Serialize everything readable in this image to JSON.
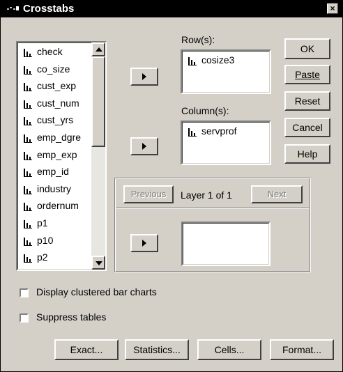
{
  "window": {
    "title": "Crosstabs",
    "close_glyph": "×"
  },
  "variables": [
    "check",
    "co_size",
    "cust_exp",
    "cust_num",
    "cust_yrs",
    "emp_dgre",
    "emp_exp",
    "emp_id",
    "industry",
    "ordernum",
    "p1",
    "p10",
    "p2"
  ],
  "rows": {
    "label": "Row(s):",
    "items": [
      "cosize3"
    ]
  },
  "columns": {
    "label": "Column(s):",
    "items": [
      "servprof"
    ]
  },
  "layer": {
    "previous": "Previous",
    "text": "Layer 1 of 1",
    "next": "Next",
    "items": []
  },
  "buttons": {
    "ok": "OK",
    "paste": "Paste",
    "reset": "Reset",
    "cancel": "Cancel",
    "help": "Help"
  },
  "options": {
    "clustered_bar": {
      "label": "Display clustered bar charts",
      "checked": false
    },
    "suppress_tables": {
      "label": "Suppress tables",
      "checked": false
    }
  },
  "bottom_buttons": {
    "exact": "Exact...",
    "statistics": "Statistics...",
    "cells": "Cells...",
    "format": "Format..."
  },
  "icons": {
    "variable": "scale-variable-icon",
    "title": "crosstabs-window-icon",
    "move": "arrow-right-icon"
  },
  "colors": {
    "face": "#d4d0c8",
    "titlebar": "#000000",
    "field": "#ffffff"
  }
}
